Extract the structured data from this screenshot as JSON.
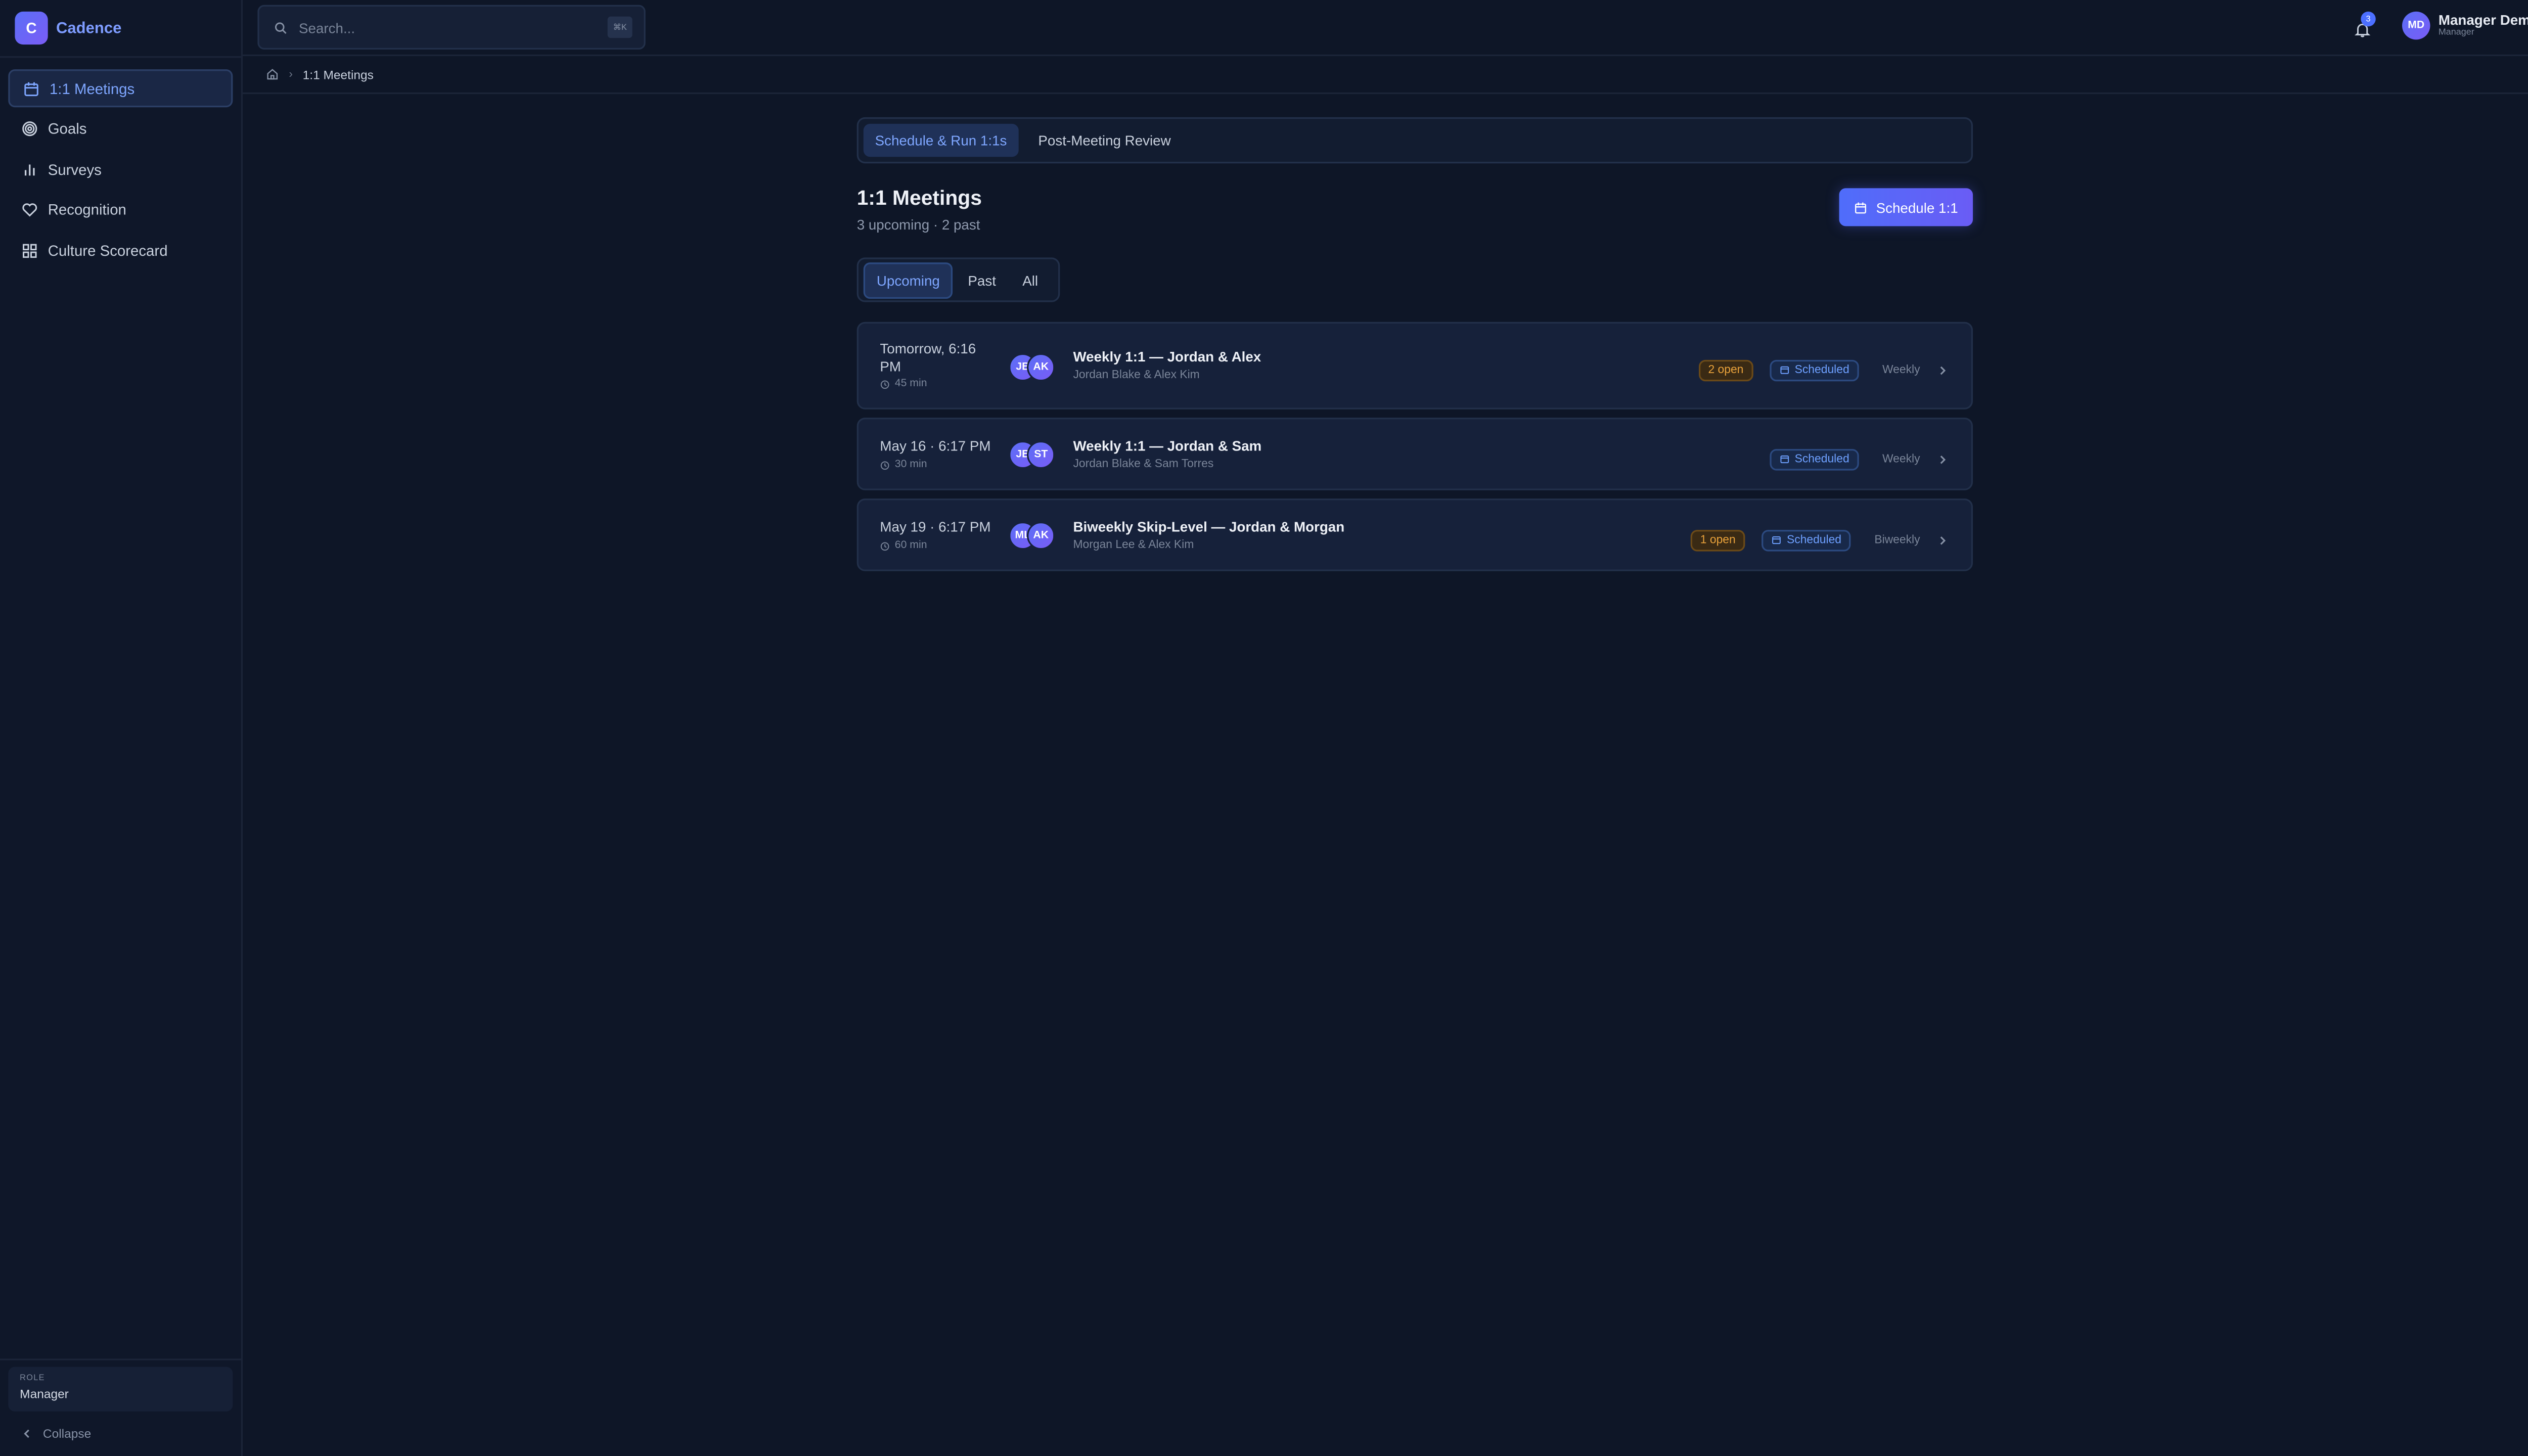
{
  "app": {
    "name": "Cadence",
    "logo_letter": "C"
  },
  "sidebar": {
    "items": [
      {
        "label": "1:1 Meetings",
        "icon": "calendar-icon",
        "active": true
      },
      {
        "label": "Goals",
        "icon": "target-icon"
      },
      {
        "label": "Surveys",
        "icon": "bar-chart-icon"
      },
      {
        "label": "Recognition",
        "icon": "heart-icon"
      },
      {
        "label": "Culture Scorecard",
        "icon": "grid-icon"
      }
    ],
    "role_label": "ROLE",
    "role_value": "Manager",
    "collapse_label": "Collapse"
  },
  "search": {
    "placeholder": "Search...",
    "shortcut": "⌘K"
  },
  "notifications": {
    "count": "3"
  },
  "user": {
    "initials": "MD",
    "name": "Manager Demo",
    "role": "Manager"
  },
  "breadcrumb": {
    "current": "1:1 Meetings"
  },
  "mode_tabs": [
    "Schedule & Run 1:1s",
    "Post-Meeting Review"
  ],
  "page": {
    "title": "1:1 Meetings",
    "subtitle": "3 upcoming · 2 past",
    "schedule_button": "Schedule 1:1"
  },
  "filter_tabs": [
    "Upcoming",
    "Past",
    "All"
  ],
  "meetings": [
    {
      "time": "Tomorrow, 6:16 PM",
      "duration": "45 min",
      "avatars": [
        "JB",
        "AK"
      ],
      "title": "Weekly 1:1 — Jordan & Alex",
      "people": "Jordan Blake & Alex Kim",
      "open": "2 open",
      "status": "Scheduled",
      "frequency": "Weekly"
    },
    {
      "time": "May 16 · 6:17 PM",
      "duration": "30 min",
      "avatars": [
        "JB",
        "ST"
      ],
      "title": "Weekly 1:1 — Jordan & Sam",
      "people": "Jordan Blake & Sam Torres",
      "open": "",
      "status": "Scheduled",
      "frequency": "Weekly"
    },
    {
      "time": "May 19 · 6:17 PM",
      "duration": "60 min",
      "avatars": [
        "ML",
        "AK"
      ],
      "title": "Biweekly Skip-Level — Jordan & Morgan",
      "people": "Morgan Lee & Alex Kim",
      "open": "1 open",
      "status": "Scheduled",
      "frequency": "Biweekly"
    }
  ],
  "colors": {
    "accent": "#4f6dfa",
    "background": "#0e1627",
    "warning": "#e9a23b",
    "info": "#6ea0ff"
  }
}
